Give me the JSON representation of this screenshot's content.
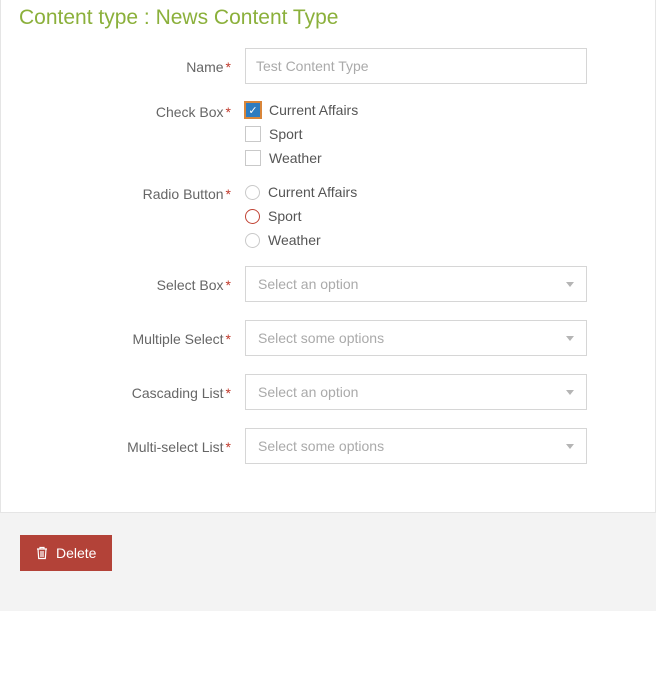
{
  "header": {
    "title": "Content type : News Content Type"
  },
  "form": {
    "name": {
      "label": "Name",
      "placeholder": "Test Content Type"
    },
    "checkbox": {
      "label": "Check Box",
      "options": [
        {
          "label": "Current Affairs",
          "checked": true
        },
        {
          "label": "Sport",
          "checked": false
        },
        {
          "label": "Weather",
          "checked": false
        }
      ]
    },
    "radio": {
      "label": "Radio Button",
      "options": [
        {
          "label": "Current Affairs",
          "active": false
        },
        {
          "label": "Sport",
          "active": true
        },
        {
          "label": "Weather",
          "active": false
        }
      ]
    },
    "selectbox": {
      "label": "Select Box",
      "placeholder": "Select an option"
    },
    "multiselect": {
      "label": "Multiple Select",
      "placeholder": "Select some options"
    },
    "cascading": {
      "label": "Cascading List",
      "placeholder": "Select an option"
    },
    "multilist": {
      "label": "Multi-select List",
      "placeholder": "Select some options"
    }
  },
  "footer": {
    "delete_label": "Delete"
  }
}
